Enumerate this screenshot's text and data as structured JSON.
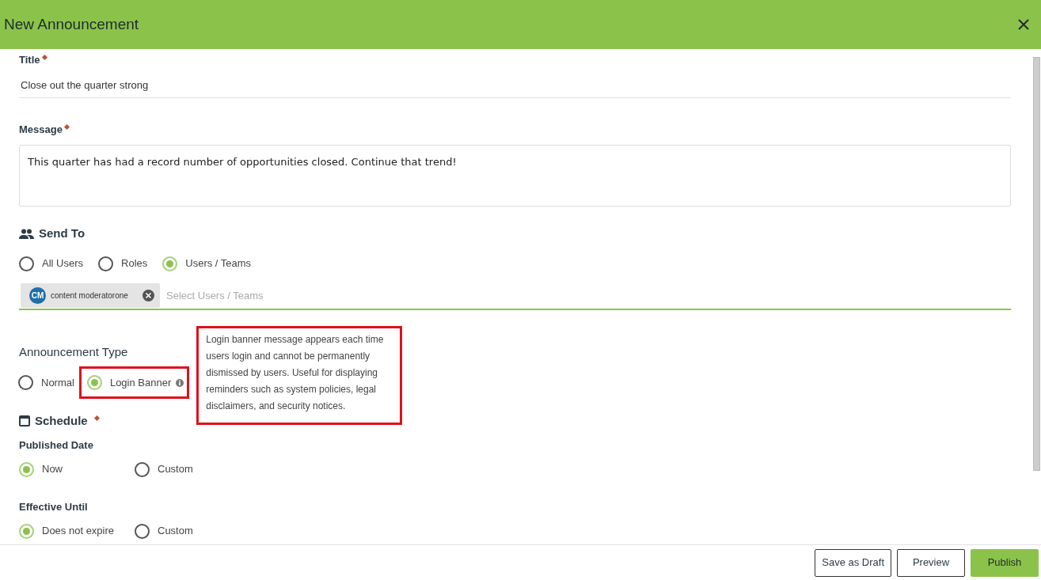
{
  "dialog": {
    "title": "New Announcement"
  },
  "title_field": {
    "label": "Title",
    "required": true,
    "value": "Close out the quarter strong"
  },
  "message_field": {
    "label": "Message",
    "required": true,
    "value": "This quarter has had a record number of opportunities closed. Continue that trend!"
  },
  "send_to": {
    "heading": "Send To",
    "options": [
      {
        "label": "All Users",
        "selected": false
      },
      {
        "label": "Roles",
        "selected": false
      },
      {
        "label": "Users / Teams",
        "selected": true
      }
    ]
  },
  "recipients": {
    "chips": [
      {
        "initials": "CM",
        "name": "content moderatorone"
      }
    ],
    "placeholder": "Select Users / Teams"
  },
  "announcement_type": {
    "heading": "Announcement Type",
    "options": [
      {
        "label": "Normal",
        "selected": false,
        "highlighted": false,
        "info": false
      },
      {
        "label": "Login Banner",
        "selected": true,
        "highlighted": true,
        "info": true
      }
    ],
    "tooltip": "Login banner message appears each time users login and cannot be permanently dismissed by users. Useful for displaying reminders such as system policies, legal disclaimers, and security notices."
  },
  "schedule": {
    "heading": "Schedule",
    "required": true,
    "groups": [
      {
        "label": "Published Date",
        "options": [
          {
            "label": "Now",
            "selected": true
          },
          {
            "label": "Custom",
            "selected": false
          }
        ]
      },
      {
        "label": "Effective Until",
        "options": [
          {
            "label": "Does not expire",
            "selected": true
          },
          {
            "label": "Custom",
            "selected": false
          }
        ]
      }
    ]
  },
  "buttons": [
    {
      "label": "Save as Draft",
      "kind": "outline"
    },
    {
      "label": "Preview",
      "kind": "outline"
    },
    {
      "label": "Publish",
      "kind": "primary"
    }
  ]
}
